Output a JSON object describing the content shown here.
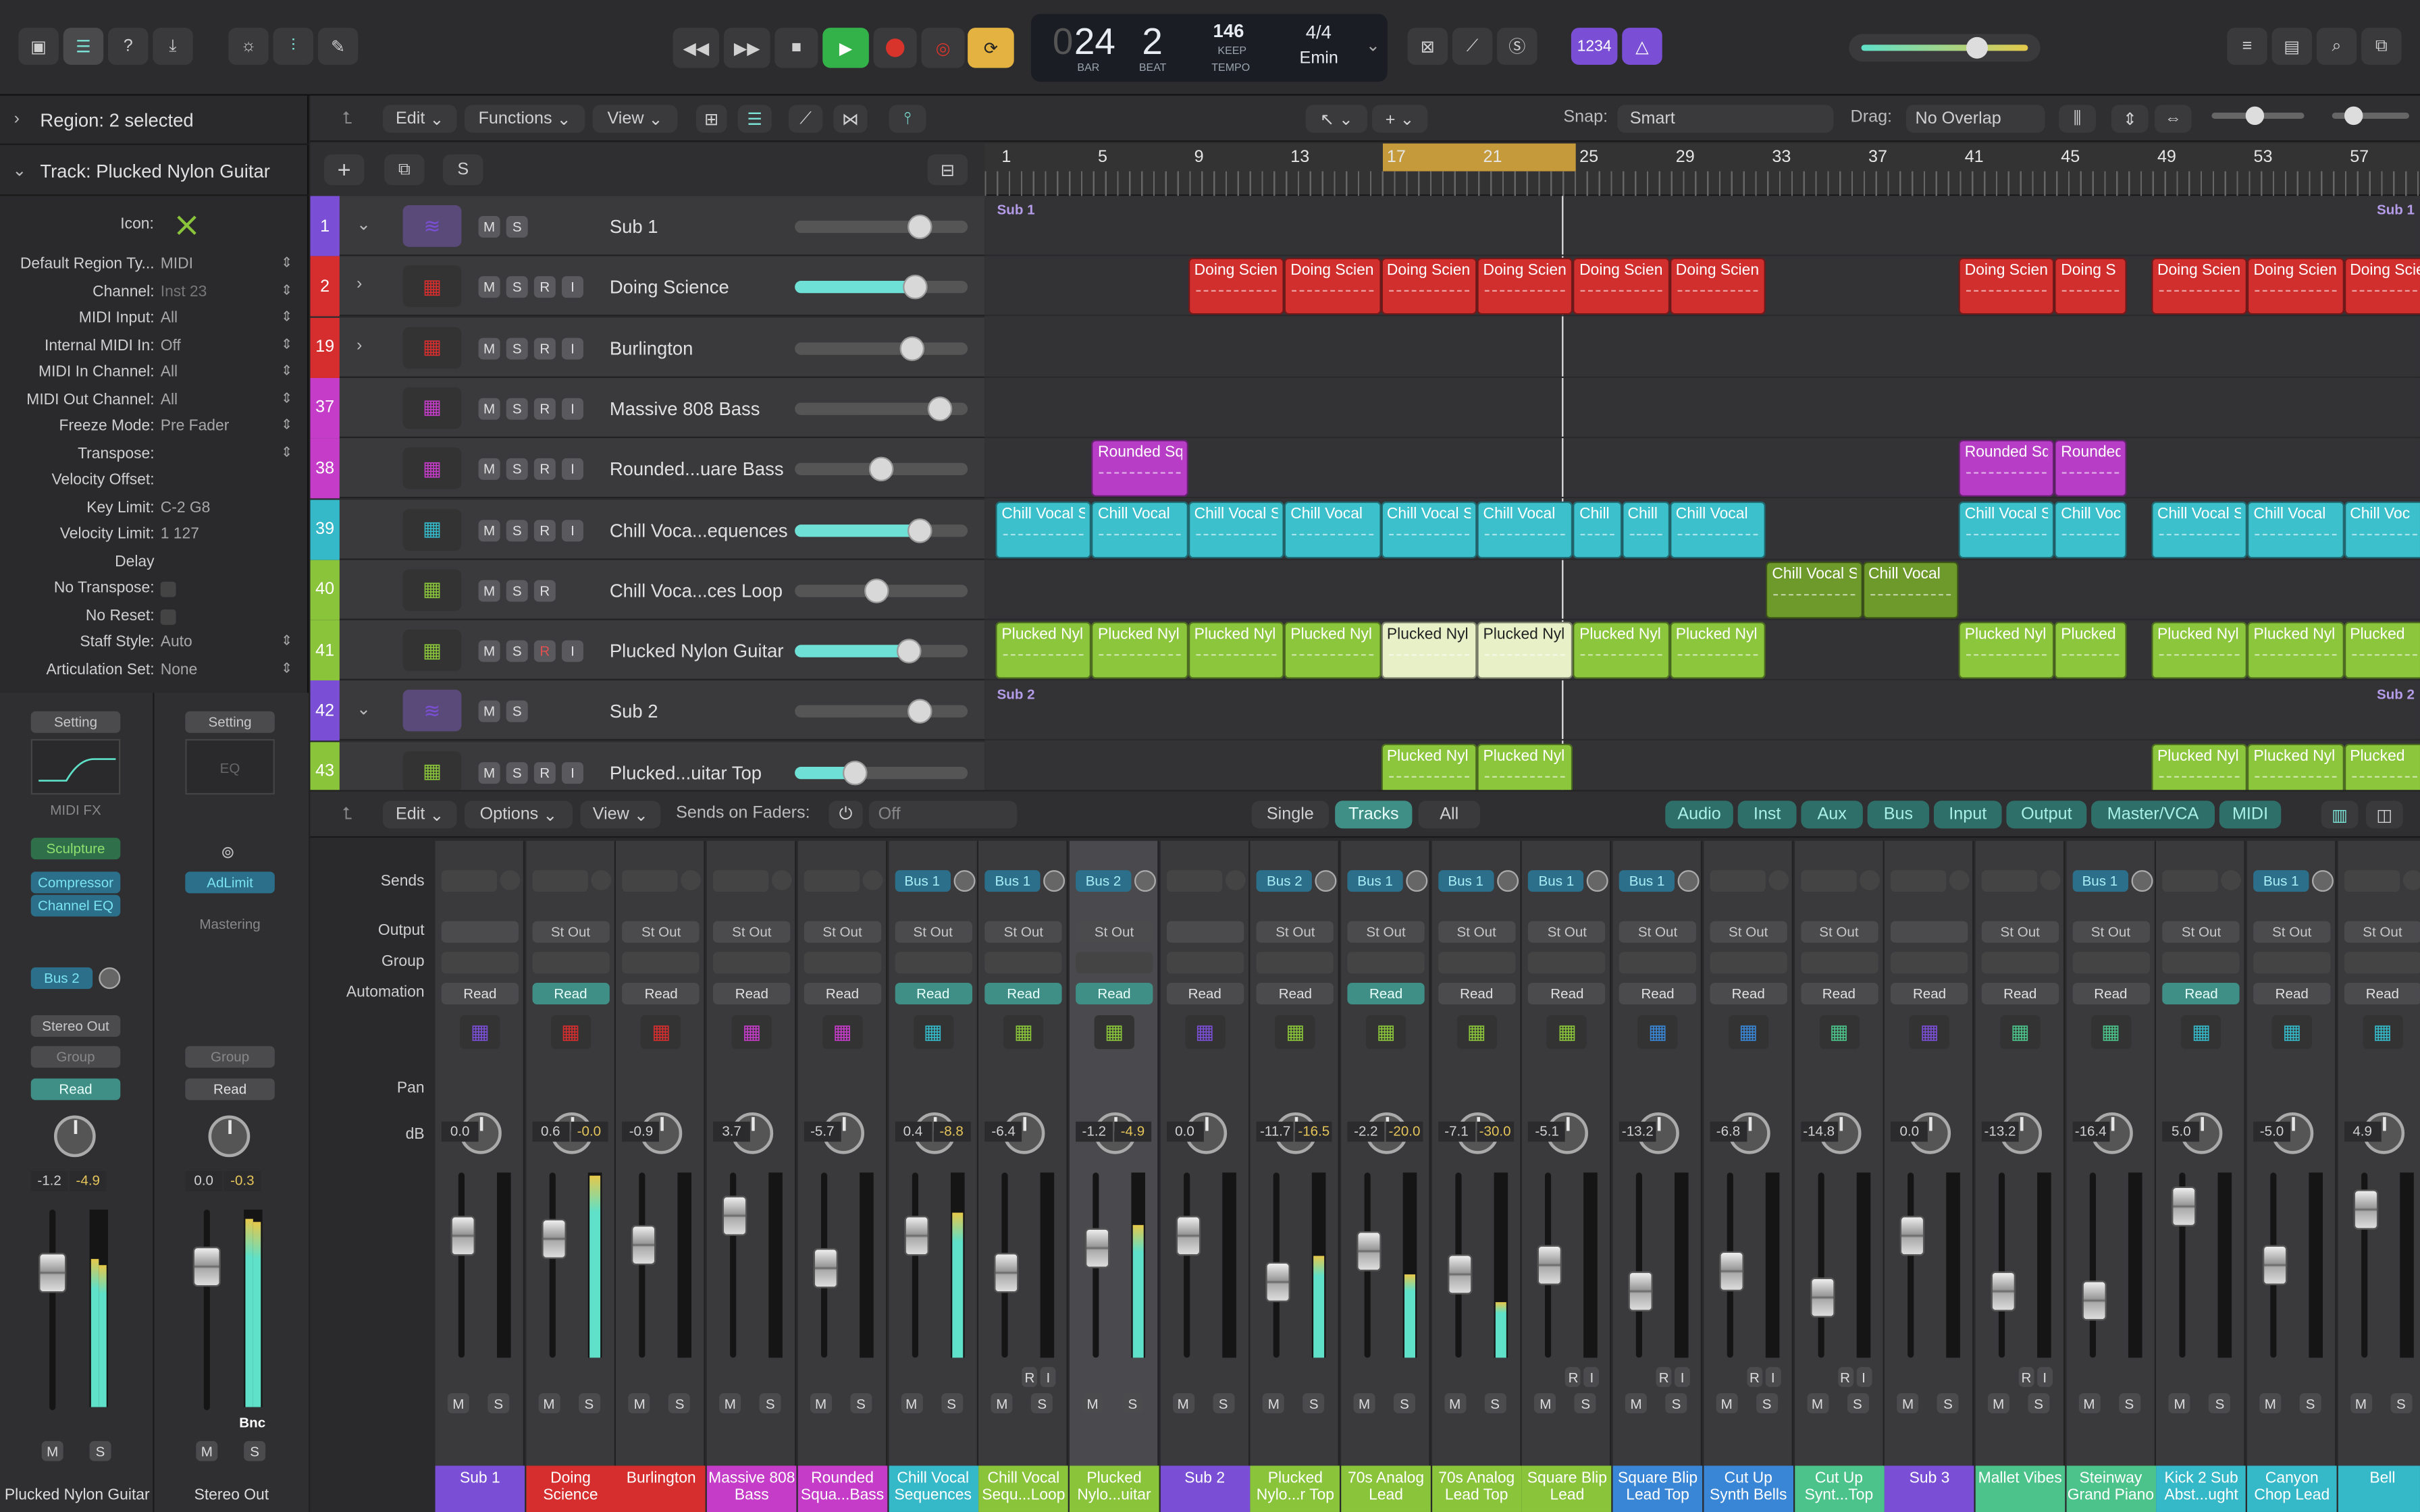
{
  "control_bar": {
    "bar": "24",
    "beat": "2",
    "bar_label": "BAR",
    "beat_label": "BEAT",
    "tempo": "146",
    "tempo_keep": "KEEP",
    "tempo_label": "TEMPO",
    "time_signature": "4/4",
    "key": "Emin",
    "lcd_lead_digit": "0",
    "count_in": "1234",
    "cycle_color": "#e3b240",
    "record_color": "#d9342b",
    "play_color": "#34b24a"
  },
  "inspector": {
    "region_header": "Region: 2 selected",
    "track_header": "Track:  Plucked Nylon Guitar",
    "icon_label": "Icon:",
    "rows": [
      {
        "label": "Default Region Ty...",
        "value": "MIDI"
      },
      {
        "label": "Channel:",
        "value": "Inst 23"
      },
      {
        "label": "MIDI Input:",
        "value": "All"
      },
      {
        "label": "Internal MIDI In:",
        "value": "Off"
      },
      {
        "label": "MIDI In Channel:",
        "value": "All"
      },
      {
        "label": "MIDI Out Channel:",
        "value": "All"
      },
      {
        "label": "Freeze Mode:",
        "value": "Pre Fader"
      },
      {
        "label": "Transpose:",
        "value": ""
      },
      {
        "label": "Velocity Offset:",
        "value": ""
      },
      {
        "label": "Key Limit:",
        "value": "C-2  G8"
      },
      {
        "label": "Velocity Limit:",
        "value": "1  127"
      },
      {
        "label": "Delay",
        "value": ""
      },
      {
        "label": "No Transpose:",
        "value": ""
      },
      {
        "label": "No Reset:",
        "value": ""
      },
      {
        "label": "Staff Style:",
        "value": "Auto"
      },
      {
        "label": "Articulation Set:",
        "value": "None"
      }
    ],
    "strip_left": {
      "setting": "Setting",
      "midi_fx": "MIDI FX",
      "plugins": [
        "Sculpture",
        "Compressor",
        "Channel EQ"
      ],
      "send": "Bus 2",
      "output": "Stereo Out",
      "group": "Group",
      "automation": "Read",
      "db": "-1.2",
      "peak": "-4.9",
      "mute": "M",
      "solo": "S",
      "name": "Plucked Nylon Guitar"
    },
    "strip_right": {
      "setting": "Setting",
      "eq": "EQ",
      "plugins": [
        "AdLimit"
      ],
      "mastering": "Mastering",
      "group": "Group",
      "automation": "Read",
      "db": "0.0",
      "peak": "-0.3",
      "bnc": "Bnc",
      "mute": "M",
      "solo": "S",
      "name": "Stereo Out"
    }
  },
  "tracks_toolbar": {
    "edit": "Edit",
    "functions": "Functions",
    "view": "View",
    "snap_label": "Snap:",
    "snap_value": "Smart",
    "drag_label": "Drag:",
    "drag_value": "No Overlap",
    "s_button": "S"
  },
  "ruler": [
    "1",
    "5",
    "9",
    "13",
    "17",
    "21",
    "25",
    "29",
    "33",
    "37",
    "41",
    "45",
    "49",
    "53",
    "57"
  ],
  "tracks": [
    {
      "num": "1",
      "name": "Sub 1",
      "color": "#7a4fd6",
      "buttons": [
        "M",
        "S"
      ],
      "volume": 0.72,
      "fill": false,
      "folder": true,
      "disclosure": "⌄"
    },
    {
      "num": "2",
      "name": "Doing Science",
      "color": "#d62e2e",
      "buttons": [
        "M",
        "S",
        "R",
        "I"
      ],
      "volume": 0.7,
      "fill": true,
      "disclosure": "›"
    },
    {
      "num": "19",
      "name": "Burlington",
      "color": "#d62e2e",
      "buttons": [
        "M",
        "S",
        "R",
        "I"
      ],
      "volume": 0.68,
      "fill": false,
      "disclosure": "›"
    },
    {
      "num": "37",
      "name": "Massive 808 Bass",
      "color": "#c43cc8",
      "buttons": [
        "M",
        "S",
        "R",
        "I"
      ],
      "volume": 0.84,
      "fill": false
    },
    {
      "num": "38",
      "name": "Rounded...uare Bass",
      "color": "#c43cc8",
      "buttons": [
        "M",
        "S",
        "R",
        "I"
      ],
      "volume": 0.5,
      "fill": false
    },
    {
      "num": "39",
      "name": "Chill Voca...equences",
      "color": "#35b8c8",
      "buttons": [
        "M",
        "S",
        "R",
        "I"
      ],
      "volume": 0.72,
      "fill": true
    },
    {
      "num": "40",
      "name": "Chill Voca...ces Loop",
      "color": "#8ac43a",
      "buttons": [
        "M",
        "S",
        "R"
      ],
      "volume": 0.47,
      "fill": false
    },
    {
      "num": "41",
      "name": "Plucked Nylon Guitar",
      "color": "#8ac43a",
      "buttons": [
        "M",
        "S",
        "R",
        "I"
      ],
      "volume": 0.66,
      "fill": true
    },
    {
      "num": "42",
      "name": "Sub 2",
      "color": "#7a4fd6",
      "buttons": [
        "M",
        "S"
      ],
      "volume": 0.72,
      "fill": false,
      "folder": true,
      "disclosure": "⌄"
    },
    {
      "num": "43",
      "name": "Plucked...uitar Top",
      "color": "#8ac43a",
      "buttons": [
        "M",
        "S",
        "R",
        "I"
      ],
      "volume": 0.35,
      "fill": true
    }
  ],
  "regions": {
    "sub1_label": "Sub 1",
    "sub2_label": "Sub 2",
    "doing": "Doing Scien",
    "doing_short": "Doing S",
    "rounded": "Rounded Sq",
    "rounded_short": "Rounded",
    "chill_s": "Chill Vocal S",
    "chill": "Chill Vocal",
    "chill_voc": "Chill Voc",
    "chill_word": "Chill",
    "plucked": "Plucked Nyl",
    "plucked_short": "Plucked"
  },
  "mixer_toolbar": {
    "edit": "Edit",
    "options": "Options",
    "view": "View",
    "sends_label": "Sends on Faders:",
    "sends_value": "Off",
    "single": "Single",
    "tracks": "Tracks",
    "all": "All",
    "filters": [
      "Audio",
      "Inst",
      "Aux",
      "Bus",
      "Input",
      "Output",
      "Master/VCA",
      "MIDI"
    ]
  },
  "mixer_labels": {
    "sends": "Sends",
    "output": "Output",
    "group": "Group",
    "automation": "Automation",
    "pan": "Pan",
    "db": "dB"
  },
  "channels": [
    {
      "name": "Sub 1",
      "color": "#7a4fd6",
      "send": "",
      "output": "",
      "read": "Read",
      "read_on": false,
      "db": "0.0",
      "peak": "",
      "fader": 0.7,
      "meter": 0,
      "ri": false
    },
    {
      "name": "Doing Science",
      "color": "#d62e2e",
      "send": "",
      "output": "St Out",
      "read": "Read",
      "read_on": true,
      "db": "0.6",
      "peak": "-0.0",
      "fader": 0.68,
      "meter": 0.98,
      "ri": false
    },
    {
      "name": "Burlington",
      "color": "#d62e2e",
      "send": "",
      "output": "St Out",
      "read": "Read",
      "read_on": false,
      "db": "-0.9",
      "peak": "",
      "fader": 0.64,
      "meter": 0,
      "ri": false
    },
    {
      "name": "Massive 808 Bass",
      "color": "#c43cc8",
      "send": "",
      "output": "St Out",
      "read": "Read",
      "read_on": false,
      "db": "3.7",
      "peak": "",
      "fader": 0.84,
      "meter": 0,
      "ri": false
    },
    {
      "name": "Rounded Squa...Bass",
      "color": "#c43cc8",
      "send": "",
      "output": "St Out",
      "read": "Read",
      "read_on": false,
      "db": "-5.7",
      "peak": "",
      "fader": 0.48,
      "meter": 0,
      "ri": false
    },
    {
      "name": "Chill Vocal Sequences",
      "color": "#35b8c8",
      "send": "Bus 1",
      "output": "St Out",
      "read": "Read",
      "read_on": true,
      "db": "0.4",
      "peak": "-8.8",
      "fader": 0.7,
      "meter": 0.78,
      "ri": false
    },
    {
      "name": "Chill Vocal Sequ...Loop",
      "color": "#8ac43a",
      "send": "Bus 1",
      "output": "St Out",
      "read": "Read",
      "read_on": true,
      "db": "-6.4",
      "peak": "",
      "fader": 0.45,
      "meter": 0,
      "ri": true
    },
    {
      "name": "Plucked Nylo...uitar",
      "color": "#8ac43a",
      "send": "Bus 2",
      "output": "St Out",
      "read": "Read",
      "read_on": true,
      "db": "-1.2",
      "peak": "-4.9",
      "fader": 0.62,
      "meter": 0.72,
      "ri": false,
      "selected": true
    },
    {
      "name": "Sub 2",
      "color": "#7a4fd6",
      "send": "",
      "output": "",
      "read": "Read",
      "read_on": false,
      "db": "0.0",
      "peak": "",
      "fader": 0.7,
      "meter": 0,
      "ri": false
    },
    {
      "name": "Plucked Nylo...r Top",
      "color": "#8ac43a",
      "send": "Bus 2",
      "output": "St Out",
      "read": "Read",
      "read_on": false,
      "db": "-11.7",
      "peak": "-16.5",
      "fader": 0.38,
      "meter": 0.55,
      "ri": false
    },
    {
      "name": "70s Analog Lead",
      "color": "#8ac43a",
      "send": "Bus 1",
      "output": "St Out",
      "read": "Read",
      "read_on": true,
      "db": "-2.2",
      "peak": "-20.0",
      "fader": 0.6,
      "meter": 0.45,
      "ri": false
    },
    {
      "name": "70s Analog Lead Top",
      "color": "#8ac43a",
      "send": "Bus 1",
      "output": "St Out",
      "read": "Read",
      "read_on": false,
      "db": "-7.1",
      "peak": "-30.0",
      "fader": 0.44,
      "meter": 0.3,
      "ri": false
    },
    {
      "name": "Square Blip Lead",
      "color": "#8ac43a",
      "send": "Bus 1",
      "output": "St Out",
      "read": "Read",
      "read_on": false,
      "db": "-5.1",
      "peak": "",
      "fader": 0.5,
      "meter": 0,
      "ri": true
    },
    {
      "name": "Square Blip Lead Top",
      "color": "#3a86d6",
      "send": "Bus 1",
      "output": "St Out",
      "read": "Read",
      "read_on": false,
      "db": "-13.2",
      "peak": "",
      "fader": 0.32,
      "meter": 0,
      "ri": true
    },
    {
      "name": "Cut Up Synth Bells",
      "color": "#3a86d6",
      "send": "",
      "output": "St Out",
      "read": "Read",
      "read_on": false,
      "db": "-6.8",
      "peak": "",
      "fader": 0.46,
      "meter": 0,
      "ri": true
    },
    {
      "name": "Cut Up Synt...Top",
      "color": "#4cc38a",
      "send": "",
      "output": "St Out",
      "read": "Read",
      "read_on": false,
      "db": "-14.8",
      "peak": "",
      "fader": 0.28,
      "meter": 0,
      "ri": true
    },
    {
      "name": "Sub 3",
      "color": "#7a4fd6",
      "send": "",
      "output": "",
      "read": "Read",
      "read_on": false,
      "db": "0.0",
      "peak": "",
      "fader": 0.7,
      "meter": 0,
      "ri": false
    },
    {
      "name": "Mallet Vibes",
      "color": "#4cc38a",
      "send": "",
      "output": "St Out",
      "read": "Read",
      "read_on": false,
      "db": "-13.2",
      "peak": "",
      "fader": 0.32,
      "meter": 0,
      "ri": true
    },
    {
      "name": "Steinway Grand Piano",
      "color": "#4cc38a",
      "send": "Bus 1",
      "output": "St Out",
      "read": "Read",
      "read_on": false,
      "db": "-16.4",
      "peak": "",
      "fader": 0.26,
      "meter": 0,
      "ri": false
    },
    {
      "name": "Kick 2 Sub Abst...ught",
      "color": "#35b8c8",
      "send": "",
      "output": "St Out",
      "read": "Read",
      "read_on": true,
      "db": "5.0",
      "peak": "",
      "fader": 0.9,
      "meter": 0,
      "ri": false
    },
    {
      "name": "Canyon Chop Lead",
      "color": "#35b8c8",
      "send": "Bus 1",
      "output": "St Out",
      "read": "Read",
      "read_on": false,
      "db": "-5.0",
      "peak": "",
      "fader": 0.5,
      "meter": 0,
      "ri": false
    },
    {
      "name": "Bell",
      "color": "#35b8c8",
      "send": "",
      "output": "St Out",
      "read": "Read",
      "read_on": false,
      "db": "4.9",
      "peak": "",
      "fader": 0.88,
      "meter": 0,
      "ri": false
    }
  ]
}
